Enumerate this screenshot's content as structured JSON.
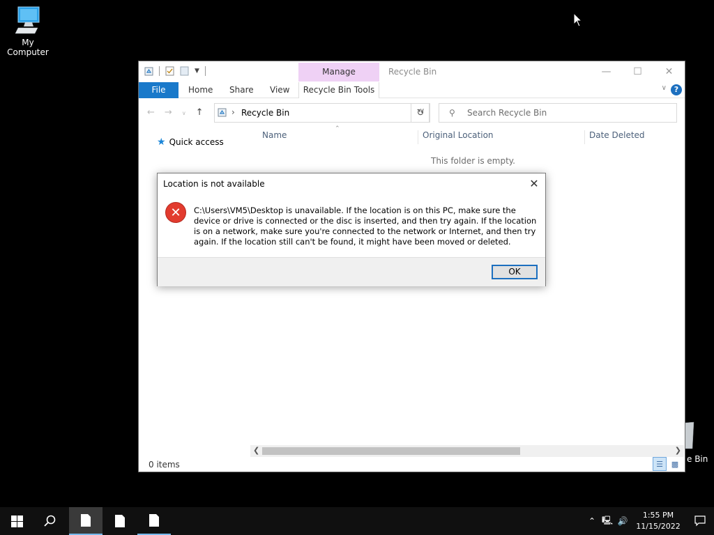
{
  "desktop": {
    "my_computer_label": "My Computer",
    "recycle_bin_label_partial": "e Bin"
  },
  "window": {
    "title": "Recycle Bin",
    "manage_tab": "Manage",
    "ribbon": {
      "file": "File",
      "home": "Home",
      "share": "Share",
      "view": "View",
      "tools": "Recycle Bin Tools",
      "help": "?"
    },
    "address": {
      "path": "Recycle Bin"
    },
    "search": {
      "placeholder": "Search Recycle Bin"
    },
    "nav": {
      "quick_access": "Quick access"
    },
    "columns": {
      "name": "Name",
      "original_location": "Original Location",
      "date_deleted": "Date Deleted"
    },
    "empty_message": "This folder is empty.",
    "status": "0 items"
  },
  "dialog": {
    "title": "Location is not available",
    "message": "C:\\Users\\VM5\\Desktop is unavailable. If the location is on this PC, make sure the device or drive is connected or the disc is inserted, and then try again. If the location is on a network, make sure you're connected to the network or Internet, and then try again. If the location still can't be found, it might have been moved or deleted.",
    "ok_label": "OK"
  },
  "taskbar": {
    "time": "1:55 PM",
    "date": "11/15/2022"
  },
  "colors": {
    "accent": "#1979ca",
    "manage_tab": "#efd1f5",
    "error": "#e23b2e"
  }
}
